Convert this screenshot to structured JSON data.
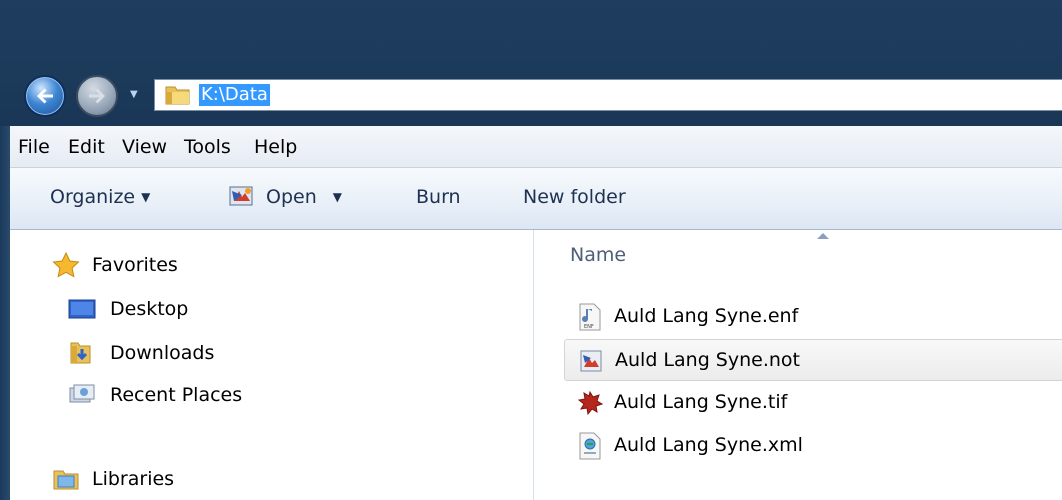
{
  "address": {
    "path": "K:\\Data"
  },
  "menu": {
    "items": [
      "File",
      "Edit",
      "View",
      "Tools",
      "Help"
    ]
  },
  "toolbar": {
    "organize": "Organize",
    "open": "Open",
    "burn": "Burn",
    "new_folder": "New folder"
  },
  "navpane": {
    "favorites": "Favorites",
    "desktop": "Desktop",
    "downloads": "Downloads",
    "recent_places": "Recent Places",
    "libraries": "Libraries"
  },
  "filelist": {
    "column_name": "Name",
    "files": [
      {
        "name": "Auld Lang Syne.enf",
        "icon": "music-document-icon"
      },
      {
        "name": "Auld Lang Syne.not",
        "icon": "notation-file-icon",
        "selected": true
      },
      {
        "name": "Auld Lang Syne.tif",
        "icon": "image-splat-icon"
      },
      {
        "name": "Auld Lang Syne.xml",
        "icon": "xml-document-icon"
      }
    ]
  },
  "colors": {
    "title_bar": "#1c3a5a",
    "selection": "#3399ff",
    "toolbar_text": "#1e3150"
  }
}
